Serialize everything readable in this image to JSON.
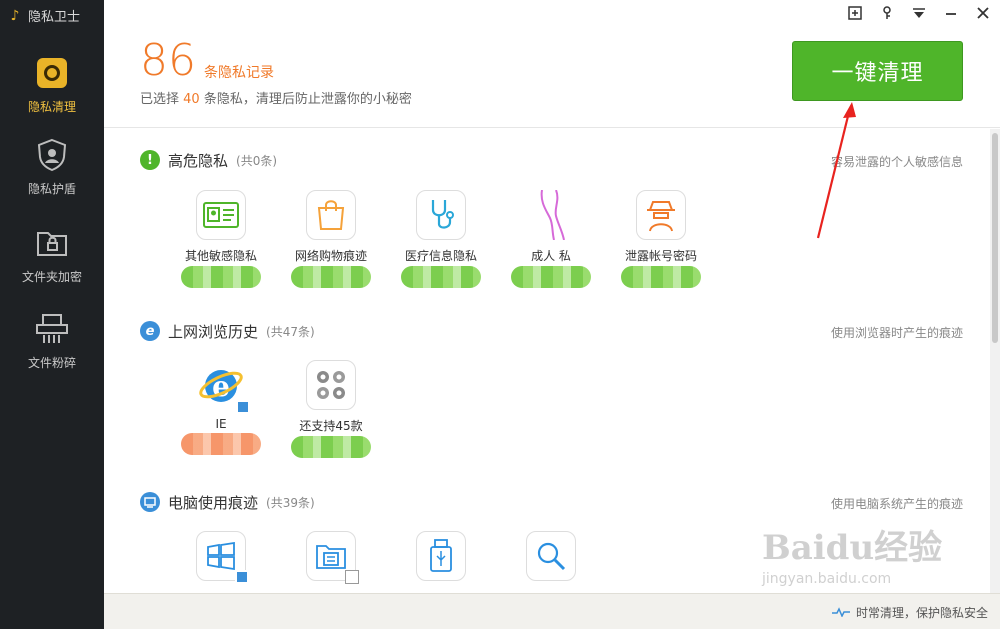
{
  "app": {
    "title": "隐私卫士"
  },
  "sidebar": {
    "items": [
      {
        "label": "隐私清理",
        "icon": "privacy-clean-icon",
        "active": true
      },
      {
        "label": "隐私护盾",
        "icon": "shield-icon",
        "active": false
      },
      {
        "label": "文件夹加密",
        "icon": "folder-lock-icon",
        "active": false
      },
      {
        "label": "文件粉碎",
        "icon": "shredder-icon",
        "active": false
      }
    ]
  },
  "window_controls": [
    "add-icon",
    "skin-icon",
    "menu-icon",
    "minimize-icon",
    "close-icon"
  ],
  "header": {
    "count": "86",
    "count_label": "条隐私记录",
    "selected_prefix": "已选择",
    "selected_count": "40",
    "selected_suffix": "条隐私，清理后防止泄露你的小秘密",
    "clean_button": "一键清理"
  },
  "sections": [
    {
      "title": "高危隐私",
      "count": "(共0条)",
      "desc": "容易泄露的个人敏感信息",
      "icon": "warning-icon",
      "color": "#4fb52a",
      "tiles": [
        {
          "label": "其他敏感隐私",
          "icon": "id-card-icon"
        },
        {
          "label": "网络购物痕迹",
          "icon": "shopping-bag-icon"
        },
        {
          "label": "医疗信息隐私",
          "icon": "stethoscope-icon"
        },
        {
          "label": "成人 私",
          "icon": "legs-icon"
        },
        {
          "label": "泄露帐号密码",
          "icon": "spy-icon"
        }
      ]
    },
    {
      "title": "上网浏览历史",
      "count": "(共47条)",
      "desc": "使用浏览器时产生的痕迹",
      "icon": "ie-icon",
      "color": "#3b8fd8",
      "tiles": [
        {
          "label": "IE",
          "icon": "internet-explorer-icon"
        },
        {
          "label": "还支持45款",
          "icon": "browsers-grid-icon"
        }
      ]
    },
    {
      "title": "电脑使用痕迹",
      "count": "(共39条)",
      "desc": "使用电脑系统产生的痕迹",
      "icon": "computer-icon",
      "color": "#3b8fd8",
      "tiles": [
        {
          "label": "",
          "icon": "windows-icon"
        },
        {
          "label": "",
          "icon": "file-explorer-icon"
        },
        {
          "label": "",
          "icon": "usb-icon"
        },
        {
          "label": "",
          "icon": "search-icon"
        }
      ]
    }
  ],
  "footer": {
    "text": "时常清理，保护隐私安全"
  },
  "watermark": {
    "line1": "Baidu经验",
    "line2": "jingyan.baidu.com"
  }
}
